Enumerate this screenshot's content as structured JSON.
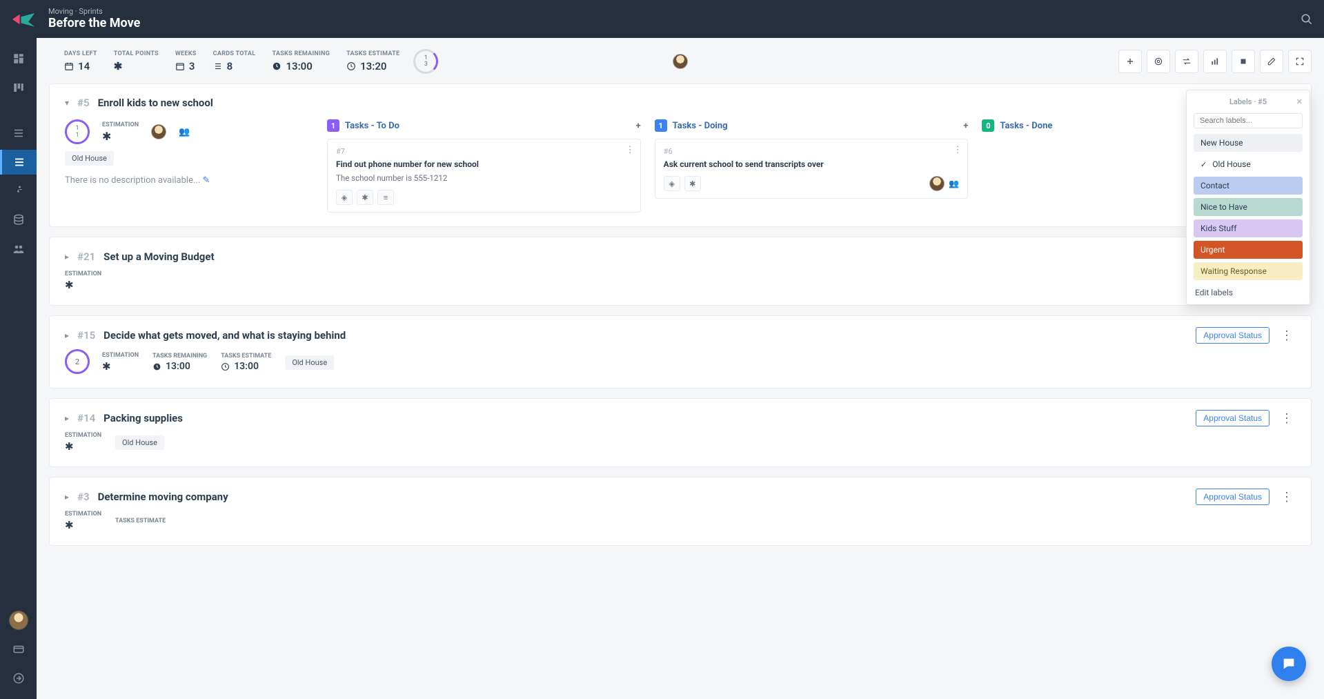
{
  "header": {
    "crumb": "Moving · Sprints",
    "title": "Before the Move"
  },
  "stats": {
    "days_left_label": "DAYS LEFT",
    "days_left": "14",
    "points_label": "TOTAL POINTS",
    "weeks_label": "WEEKS",
    "weeks": "3",
    "cards_label": "CARDS TOTAL",
    "cards": "8",
    "remain_label": "TASKS REMAINING",
    "remain": "13:00",
    "est_label": "TASKS ESTIMATE",
    "est": "13:20",
    "ring_top": "1",
    "ring_bottom": "3"
  },
  "labels_popover": {
    "title": "Labels · #5",
    "search_placeholder": "Search labels...",
    "items": [
      {
        "name": "New House",
        "bg": "#eef0f4",
        "fg": "#2c3e50",
        "checked": false
      },
      {
        "name": "Old House",
        "bg": "transparent",
        "fg": "#2c3e50",
        "checked": true
      },
      {
        "name": "Contact",
        "bg": "#b9cdf0",
        "fg": "#2c3e50",
        "checked": false
      },
      {
        "name": "Nice to Have",
        "bg": "#b7d9cf",
        "fg": "#2c3e50",
        "checked": false
      },
      {
        "name": "Kids Stuff",
        "bg": "#d9c9f2",
        "fg": "#2c3e50",
        "checked": false
      },
      {
        "name": "Urgent",
        "bg": "#d35427",
        "fg": "#ffffff",
        "checked": false
      },
      {
        "name": "Waiting Response",
        "bg": "#f8eec3",
        "fg": "#6b5b1f",
        "checked": false
      }
    ],
    "edit": "Edit labels"
  },
  "approval_label": "Approval Status",
  "cards": [
    {
      "id": "#5",
      "title": "Enroll kids to new school",
      "expanded": true,
      "ring": [
        "1",
        "1"
      ],
      "est_label": "ESTIMATION",
      "chip": "Old House",
      "desc": "There is no description available...",
      "columns": [
        {
          "color": "purple",
          "count": "1",
          "name": "Tasks - To Do",
          "tasks": [
            {
              "tid": "#7",
              "title": "Find out phone number for new school",
              "body": "The school number is 555-1212",
              "icons": [
                "warn",
                "star",
                "lines"
              ]
            }
          ]
        },
        {
          "color": "blue",
          "count": "1",
          "name": "Tasks - Doing",
          "tasks": [
            {
              "tid": "#6",
              "title": "Ask current school to send transcripts over",
              "body": "",
              "icons": [
                "warn",
                "star"
              ],
              "assignee": true
            }
          ]
        },
        {
          "color": "green",
          "count": "0",
          "name": "Tasks - Done",
          "tasks": []
        }
      ]
    },
    {
      "id": "#21",
      "title": "Set up a Moving Budget",
      "est_label": "ESTIMATION"
    },
    {
      "id": "#15",
      "title": "Decide what gets moved, and what is staying behind",
      "ring_single": "2",
      "est_label": "ESTIMATION",
      "rem_label": "TASKS REMAINING",
      "rem": "13:00",
      "test_label": "TASKS ESTIMATE",
      "test": "13:00",
      "chip": "Old House"
    },
    {
      "id": "#14",
      "title": "Packing supplies",
      "est_label": "ESTIMATION",
      "chip": "Old House"
    },
    {
      "id": "#3",
      "title": "Determine moving company",
      "est_label": "ESTIMATION",
      "test_label": "TASKS ESTIMATE"
    }
  ]
}
